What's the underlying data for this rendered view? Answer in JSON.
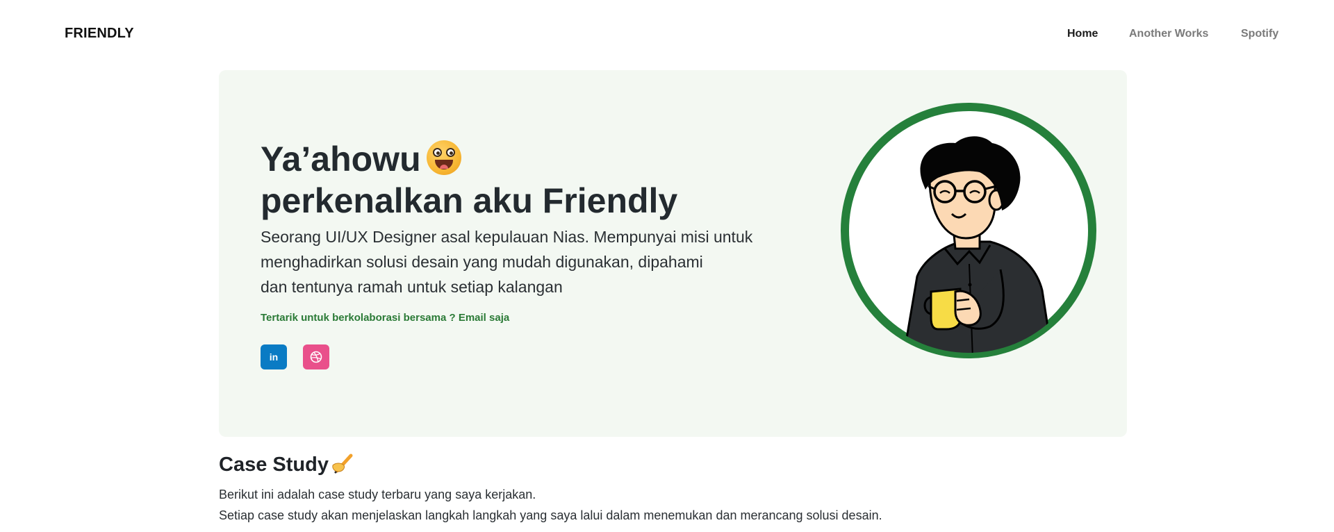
{
  "navbar": {
    "brand": "FRIENDLY",
    "links": [
      {
        "label": "Home",
        "active": true
      },
      {
        "label": "Another Works",
        "active": false
      },
      {
        "label": "Spotify",
        "active": false
      }
    ]
  },
  "hero": {
    "title_line1": "Ya’ahowu",
    "title_line2": "perkenalkan aku Friendly",
    "title_emoji": "grinning-face-emoji",
    "description_lines": [
      "Seorang UI/UX Designer asal kepulauan Nias. Mempunyai misi untuk",
      "menghadirkan solusi desain yang mudah digunakan, dipahami",
      "dan tentunya ramah untuk setiap kalangan"
    ],
    "cta": "Tertarik untuk berkolaborasi bersama ? Email saja",
    "social": [
      {
        "icon": "linkedin-icon",
        "glyph": "in",
        "color": "#0a7bc4"
      },
      {
        "icon": "dribbble-icon",
        "glyph": "",
        "color": "#e9508b"
      }
    ],
    "avatar_ring_color": "#25803b",
    "background_color": "#f3f8f2"
  },
  "case_study": {
    "title": "Case Study",
    "title_emoji": "writing-hand-emoji",
    "description_lines": [
      "Berikut ini adalah case study terbaru yang saya kerjakan.",
      "Setiap case study akan menjelaskan langkah langkah yang saya lalui dalam menemukan dan merancang solusi desain."
    ]
  }
}
